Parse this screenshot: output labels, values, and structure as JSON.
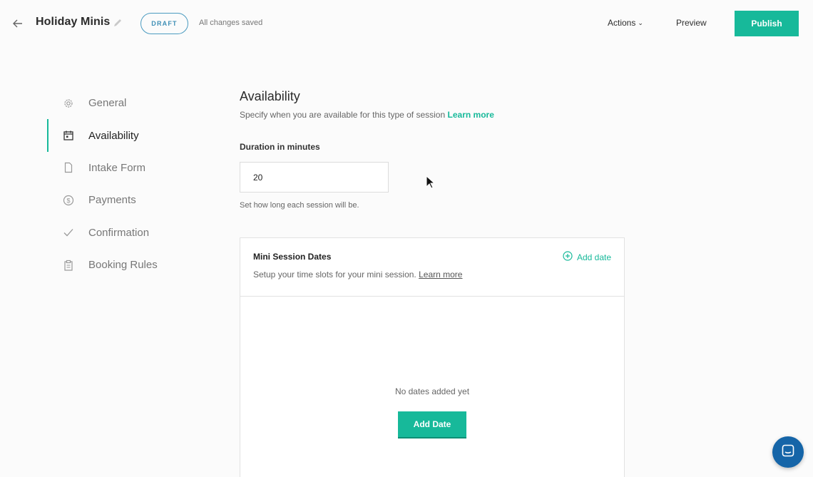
{
  "header": {
    "title": "Holiday Minis",
    "badge": "DRAFT",
    "save_status": "All changes saved",
    "actions_label": "Actions",
    "preview_label": "Preview",
    "publish_label": "Publish"
  },
  "sidebar": {
    "items": [
      {
        "label": "General",
        "icon": "gear-icon",
        "active": false
      },
      {
        "label": "Availability",
        "icon": "calendar-icon",
        "active": true
      },
      {
        "label": "Intake Form",
        "icon": "document-icon",
        "active": false
      },
      {
        "label": "Payments",
        "icon": "dollar-circle-icon",
        "active": false
      },
      {
        "label": "Confirmation",
        "icon": "checkmark-icon",
        "active": false
      },
      {
        "label": "Booking Rules",
        "icon": "clipboard-icon",
        "active": false
      }
    ]
  },
  "availability": {
    "title": "Availability",
    "description": "Specify when you are available for this type of session",
    "learn_more": "Learn more",
    "duration_label": "Duration in minutes",
    "duration_value": "20",
    "duration_help": "Set how long each session will be."
  },
  "mini_session_dates": {
    "title": "Mini Session Dates",
    "subtitle": "Setup your time slots for your mini session.",
    "learn_more": "Learn more",
    "add_date_link": "Add date",
    "empty_text": "No dates added yet",
    "add_date_button": "Add Date"
  },
  "colors": {
    "accent": "#17b99a",
    "badge_border": "#4b9bc0",
    "chat_button": "#1565a8"
  }
}
